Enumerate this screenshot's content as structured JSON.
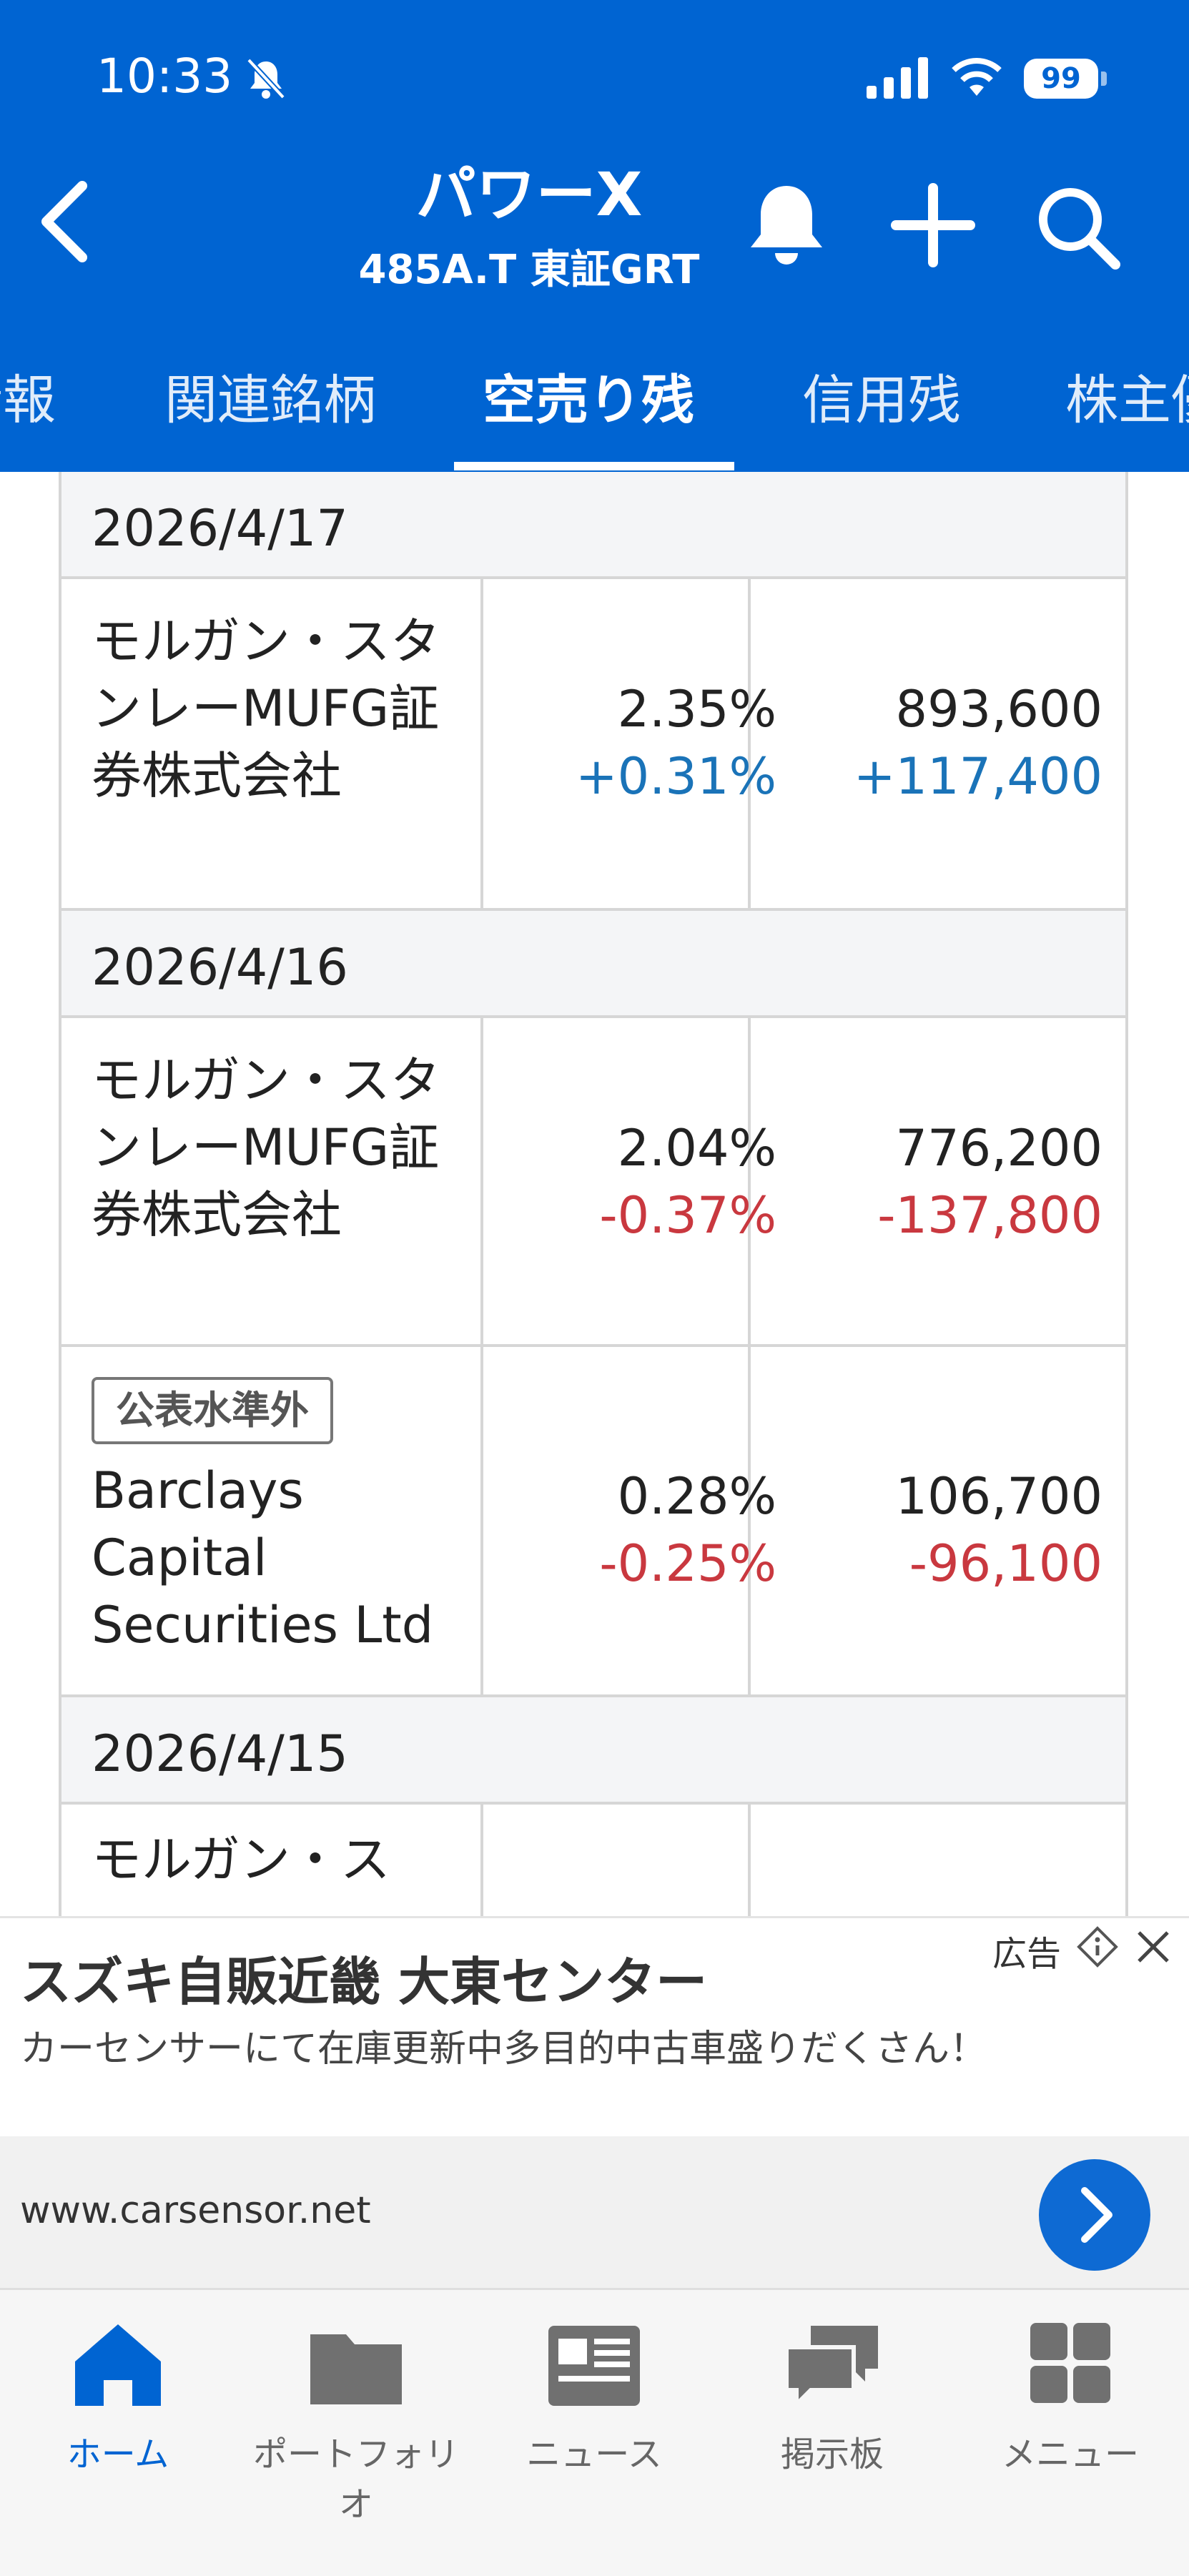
{
  "status_bar": {
    "time": "10:33",
    "battery": "99"
  },
  "header": {
    "stock_name": "パワーX",
    "stock_code": "485A.T 東証GRT"
  },
  "tabs": [
    {
      "label": "情報"
    },
    {
      "label": "関連銘柄"
    },
    {
      "label": "空売り残",
      "active": true
    },
    {
      "label": "信用残"
    },
    {
      "label": "株主優"
    }
  ],
  "short_table": {
    "groups": [
      {
        "date": "2026/4/17",
        "rows": [
          {
            "broker": "モルガン・スタンレーMUFG証券株式会社",
            "ratio": "2.35%",
            "ratio_change": "+0.31%",
            "shares": "893,600",
            "shares_change": "+117,400"
          }
        ]
      },
      {
        "date": "2026/4/16",
        "rows": [
          {
            "broker": "モルガン・スタンレーMUFG証券株式会社",
            "ratio": "2.04%",
            "ratio_change": "-0.37%",
            "shares": "776,200",
            "shares_change": "-137,800"
          },
          {
            "badge": "公表水準外",
            "broker": "Barclays Capital Securities Ltd",
            "ratio": "0.28%",
            "ratio_change": "-0.25%",
            "shares": "106,700",
            "shares_change": "-96,100"
          }
        ]
      },
      {
        "date": "2026/4/15",
        "rows": [
          {
            "broker": "モルガン・ス"
          }
        ]
      }
    ]
  },
  "ad": {
    "label": "広告",
    "title": "スズキ自販近畿 大東センター",
    "description": "カーセンサーにて在庫更新中多目的中古車盛りだくさん！",
    "url": "www.carsensor.net"
  },
  "bottom_nav": [
    {
      "label": "ホーム",
      "active": true
    },
    {
      "label": "ポートフォリオ"
    },
    {
      "label": "ニュース"
    },
    {
      "label": "掲示板"
    },
    {
      "label": "メニュー"
    }
  ],
  "colors": {
    "brand": "#0064d2",
    "positive": "#1a73b8",
    "negative": "#c9383f"
  }
}
